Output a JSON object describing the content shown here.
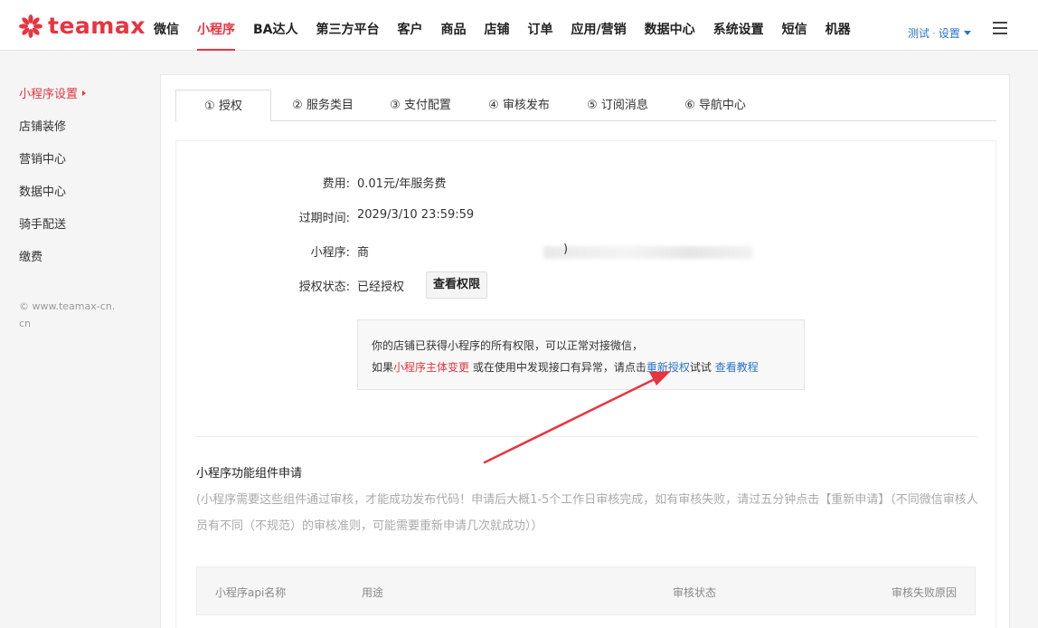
{
  "brand": {
    "logo_text": "teamax",
    "accent": "#e8343f"
  },
  "nav": {
    "items": [
      {
        "label": "微信",
        "active": false
      },
      {
        "label": "小程序",
        "active": true
      },
      {
        "label": "BA达人",
        "active": false
      },
      {
        "label": "第三方平台",
        "active": false
      },
      {
        "label": "客户",
        "active": false
      },
      {
        "label": "商品",
        "active": false
      },
      {
        "label": "店铺",
        "active": false
      },
      {
        "label": "订单",
        "active": false
      },
      {
        "label": "应用/营销",
        "active": false
      },
      {
        "label": "数据中心",
        "active": false
      },
      {
        "label": "系统设置",
        "active": false
      },
      {
        "label": "短信",
        "active": false
      },
      {
        "label": "机器",
        "active": false
      }
    ],
    "user": {
      "name": "测试",
      "settings": "设置"
    }
  },
  "sidebar": {
    "items": [
      {
        "label": "小程序设置",
        "active": true
      },
      {
        "label": "店铺装修",
        "active": false
      },
      {
        "label": "营销中心",
        "active": false
      },
      {
        "label": "数据中心",
        "active": false
      },
      {
        "label": "骑手配送",
        "active": false
      },
      {
        "label": "缴费",
        "active": false
      }
    ],
    "copyright": "© www.teamax-cn.cn"
  },
  "tabs": [
    {
      "label": "① 授权",
      "active": true
    },
    {
      "label": "② 服务类目",
      "active": false
    },
    {
      "label": "③ 支付配置",
      "active": false
    },
    {
      "label": "④ 审核发布",
      "active": false
    },
    {
      "label": "⑤ 订阅消息",
      "active": false
    },
    {
      "label": "⑥ 导航中心",
      "active": false
    }
  ],
  "auth": {
    "fee_label": "费用:",
    "fee_value": "0.01元/年服务费",
    "expire_label": "过期时间:",
    "expire_value": "2029/3/10 23:59:59",
    "app_label": "小程序:",
    "app_value_prefix": "商",
    "app_value_suffix": ")",
    "status_label": "授权状态:",
    "status_value": "已经授权",
    "view_perm_button": "查看权限"
  },
  "notice": {
    "line1": "你的店铺已获得小程序的所有权限，可以正常对接微信，",
    "line2_pre": "如果",
    "line2_red": "小程序主体变更",
    "line2_mid": " 或在使用中发现接口有异常，请点击",
    "line2_link1": "重新授权",
    "line2_post": "试试 ",
    "line2_link2": "查看教程"
  },
  "components": {
    "title": "小程序功能组件申请",
    "note": "(小程序需要这些组件通过审核，才能成功发布代码！申请后大概1-5个工作日审核完成，如有审核失败，请过五分钟点击【重新申请】（不同微信审核人员有不同（不规范）的审核准则，可能需要重新申请几次就成功））",
    "columns": [
      "小程序api名称",
      "用途",
      "审核状态",
      "审核失败原因"
    ]
  }
}
